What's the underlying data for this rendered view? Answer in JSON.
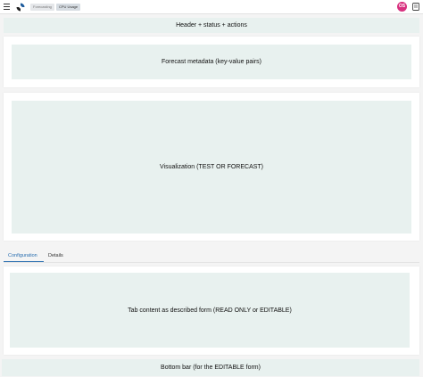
{
  "topbar": {
    "menu_icon": "hamburger-menu-icon",
    "logo_icon": "app-logo-icon",
    "breadcrumbs": [
      "Forecasting",
      "CPU Usage"
    ],
    "avatar_initials": "OS",
    "doc_icon": "document-icon"
  },
  "sections": {
    "header": "Header + status + actions",
    "metadata": "Forecast metadata (key-value pairs)",
    "visualization": "Visualization (TEST OR FORECAST)",
    "tab_content": "Tab content as described form (READ ONLY or EDITABLE)",
    "bottom_bar": "Bottom bar (for the EDITABLE form)"
  },
  "tabs": [
    {
      "label": "Configuration",
      "active": true
    },
    {
      "label": "Details",
      "active": false
    }
  ],
  "colors": {
    "placeholder_bg": "#e8f1ef",
    "accent": "#2a6fb0",
    "avatar": "#d8317f"
  }
}
